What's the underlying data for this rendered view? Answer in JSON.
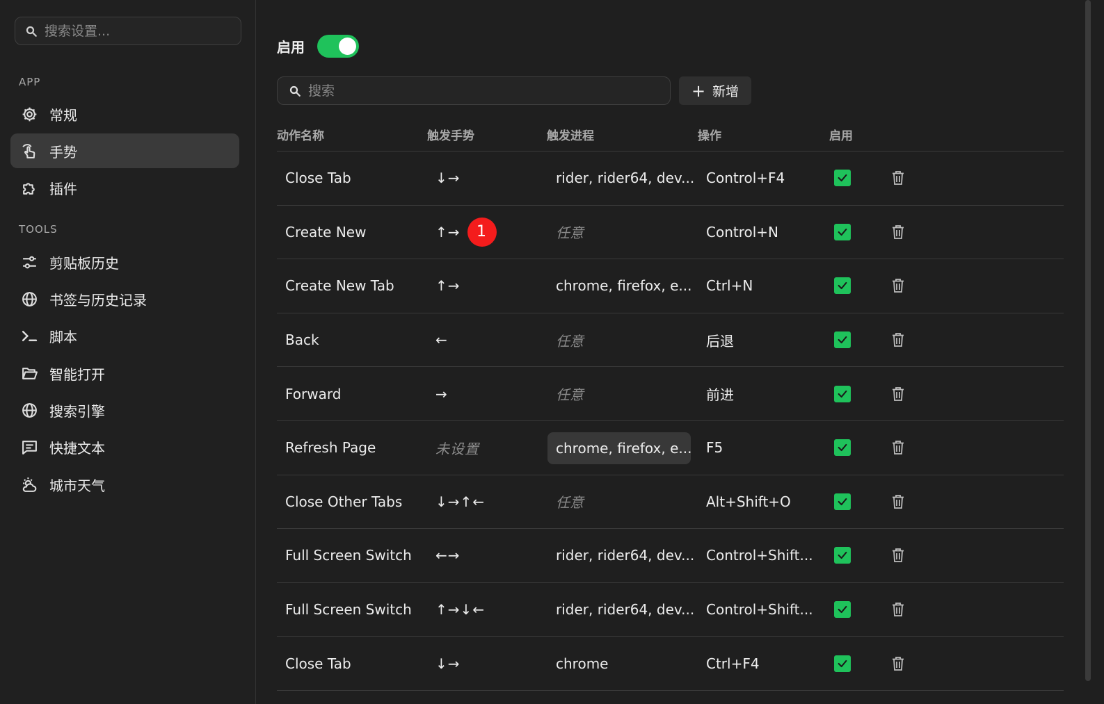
{
  "sidebar": {
    "search_placeholder": "搜索设置...",
    "sections": [
      {
        "label": "APP"
      },
      {
        "label": "TOOLS"
      }
    ],
    "items": [
      {
        "label": "常规",
        "icon": "gear-icon"
      },
      {
        "label": "手势",
        "icon": "gesture-hand-icon",
        "active": true
      },
      {
        "label": "插件",
        "icon": "puzzle-icon"
      },
      {
        "label": "剪贴板历史",
        "icon": "sliders-icon"
      },
      {
        "label": "书签与历史记录",
        "icon": "globe-icon"
      },
      {
        "label": "脚本",
        "icon": "terminal-icon"
      },
      {
        "label": "智能打开",
        "icon": "folder-open-icon"
      },
      {
        "label": "搜索引擎",
        "icon": "globe-icon"
      },
      {
        "label": "快捷文本",
        "icon": "message-icon"
      },
      {
        "label": "城市天气",
        "icon": "weather-icon"
      }
    ]
  },
  "main": {
    "enable_label": "启用",
    "enabled": true,
    "search_placeholder": "搜索",
    "add_label": "新增",
    "columns": [
      "动作名称",
      "触发手势",
      "触发进程",
      "操作",
      "启用"
    ],
    "rows": [
      {
        "name": "Close Tab",
        "gesture": "↓→",
        "process": "rider, rider64, dev...",
        "operation": "Control+F4",
        "enabled": true
      },
      {
        "name": "Create New",
        "gesture": "↑→",
        "process": "任意",
        "operation": "Control+N",
        "enabled": true,
        "badge": "1"
      },
      {
        "name": "Create New Tab",
        "gesture": "↑→",
        "process": "chrome, firefox, e...",
        "operation": "Ctrl+N",
        "enabled": true
      },
      {
        "name": "Back",
        "gesture": "←",
        "process": "任意",
        "operation": "后退",
        "enabled": true
      },
      {
        "name": "Forward",
        "gesture": "→",
        "process": "任意",
        "operation": "前进",
        "enabled": true
      },
      {
        "name": "Refresh Page",
        "gesture": "未设置",
        "process": "chrome, firefox, e...",
        "operation": "F5",
        "enabled": true
      },
      {
        "name": "Close Other Tabs",
        "gesture": "↓→↑←",
        "process": "任意",
        "operation": "Alt+Shift+O",
        "enabled": true
      },
      {
        "name": "Full Screen Switch",
        "gesture": "←→",
        "process": "rider, rider64, dev...",
        "operation": "Control+Shift...",
        "enabled": true
      },
      {
        "name": "Full Screen Switch",
        "gesture": "↑→↓←",
        "process": "rider, rider64, dev...",
        "operation": "Control+Shift...",
        "enabled": true
      },
      {
        "name": "Close Tab",
        "gesture": "↓→",
        "process": "chrome",
        "operation": "Ctrl+F4",
        "enabled": true
      }
    ]
  },
  "colors": {
    "accent": "#1fc25b",
    "badge": "#f41c1c",
    "background": "#1f1f1f"
  }
}
